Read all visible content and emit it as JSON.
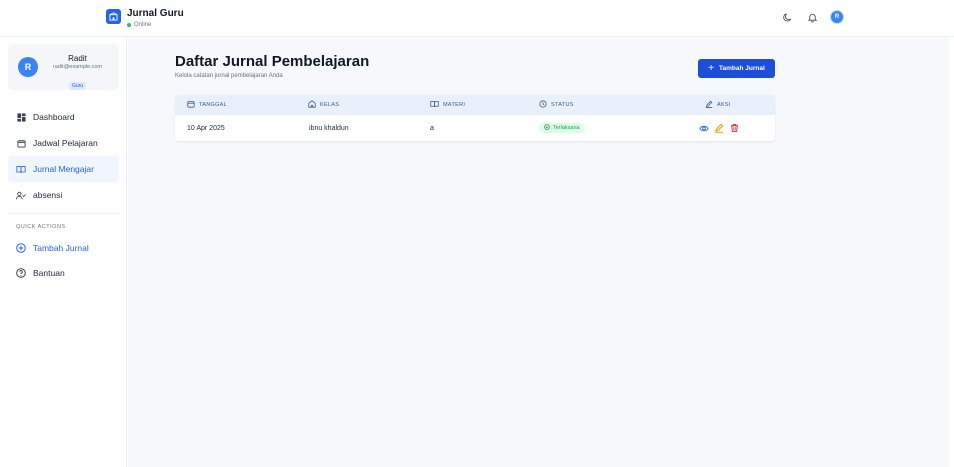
{
  "header": {
    "title": "Jurnal Guru",
    "status": "Online",
    "avatar_initial": "R"
  },
  "profile": {
    "initial": "R",
    "name": "Radit",
    "email": "radit@example.com",
    "role": "Guru"
  },
  "nav": [
    {
      "label": "Dashboard",
      "icon": "dashboard-icon"
    },
    {
      "label": "Jadwal Pelajaran",
      "icon": "calendar-icon"
    },
    {
      "label": "Jurnal Mengajar",
      "icon": "book-icon",
      "active": true
    },
    {
      "label": "absensi",
      "icon": "user-check-icon"
    }
  ],
  "quick_actions": {
    "title": "QUICK ACTIONS",
    "items": [
      {
        "label": "Tambah Jurnal",
        "icon": "plus-circle-icon"
      },
      {
        "label": "Bantuan",
        "icon": "help-circle-icon"
      }
    ]
  },
  "main": {
    "title": "Daftar Jurnal Pembelajaran",
    "subtitle": "Kelola catatan jurnal pembelajaran Anda",
    "add_button": "Tambah Jurnal"
  },
  "table": {
    "headers": [
      "TANGGAL",
      "KELAS",
      "MATERI",
      "STATUS",
      "AKSI"
    ],
    "rows": [
      {
        "tanggal": "10 Apr 2025",
        "kelas": "ibnu khaldun",
        "materi": "a",
        "status": "Terlaksana"
      }
    ]
  },
  "colors": {
    "accent": "#2563eb",
    "button": "#1d4ed8",
    "status_ok": "#16a34a",
    "edit": "#f59e0b",
    "delete": "#dc2626"
  }
}
